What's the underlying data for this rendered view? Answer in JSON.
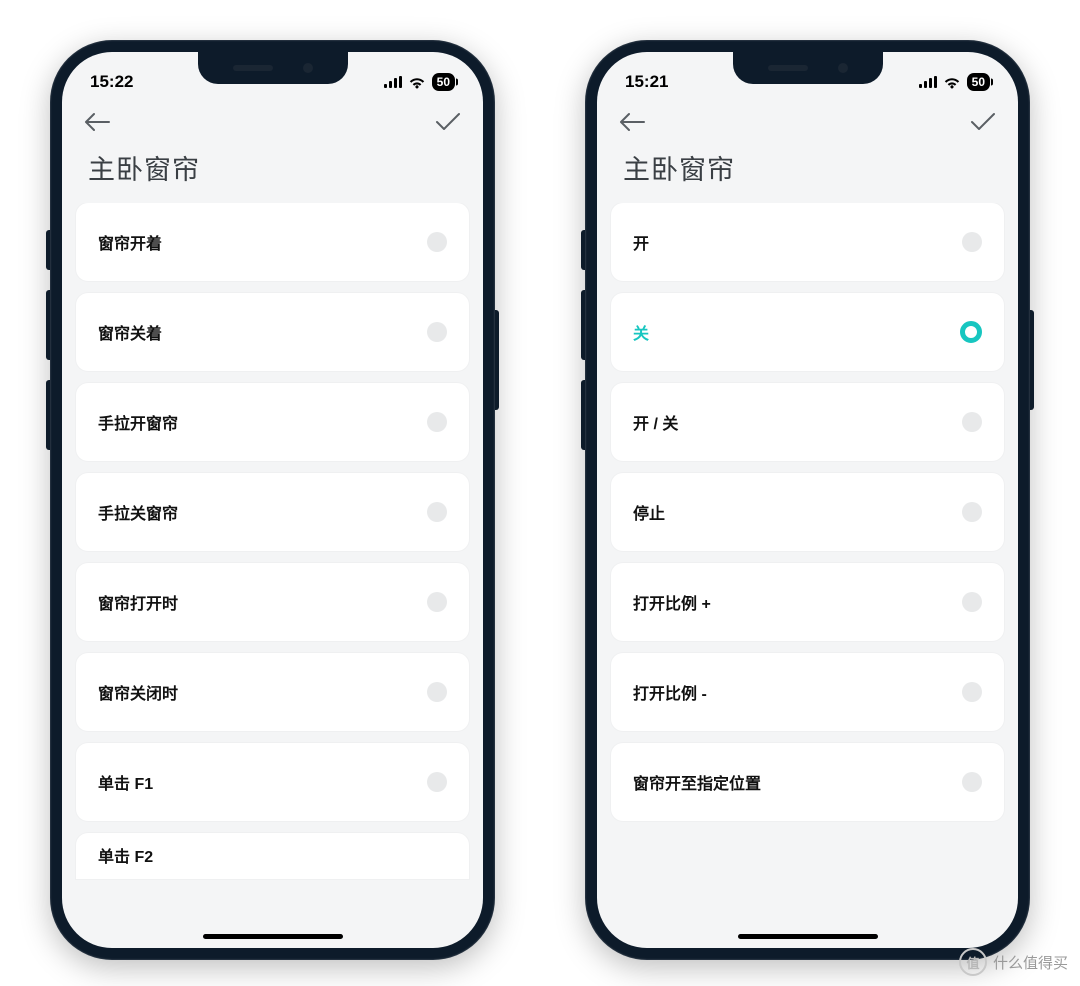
{
  "phones": {
    "left": {
      "status": {
        "time": "15:22",
        "battery": "50"
      },
      "title": "主卧窗帘",
      "items": [
        {
          "label": "窗帘开着",
          "selected": false
        },
        {
          "label": "窗帘关着",
          "selected": false
        },
        {
          "label": "手拉开窗帘",
          "selected": false
        },
        {
          "label": "手拉关窗帘",
          "selected": false
        },
        {
          "label": "窗帘打开时",
          "selected": false
        },
        {
          "label": "窗帘关闭时",
          "selected": false
        },
        {
          "label": "单击 F1",
          "selected": false
        },
        {
          "label": "单击 F2",
          "selected": false,
          "partial": true
        }
      ]
    },
    "right": {
      "status": {
        "time": "15:21",
        "battery": "50"
      },
      "title": "主卧窗帘",
      "items": [
        {
          "label": "开",
          "selected": false
        },
        {
          "label": "关",
          "selected": true
        },
        {
          "label": "开 / 关",
          "selected": false
        },
        {
          "label": "停止",
          "selected": false
        },
        {
          "label": "打开比例 +",
          "selected": false
        },
        {
          "label": "打开比例 -",
          "selected": false
        },
        {
          "label": "窗帘开至指定位置",
          "selected": false
        }
      ]
    }
  },
  "watermark": "什么值得买"
}
